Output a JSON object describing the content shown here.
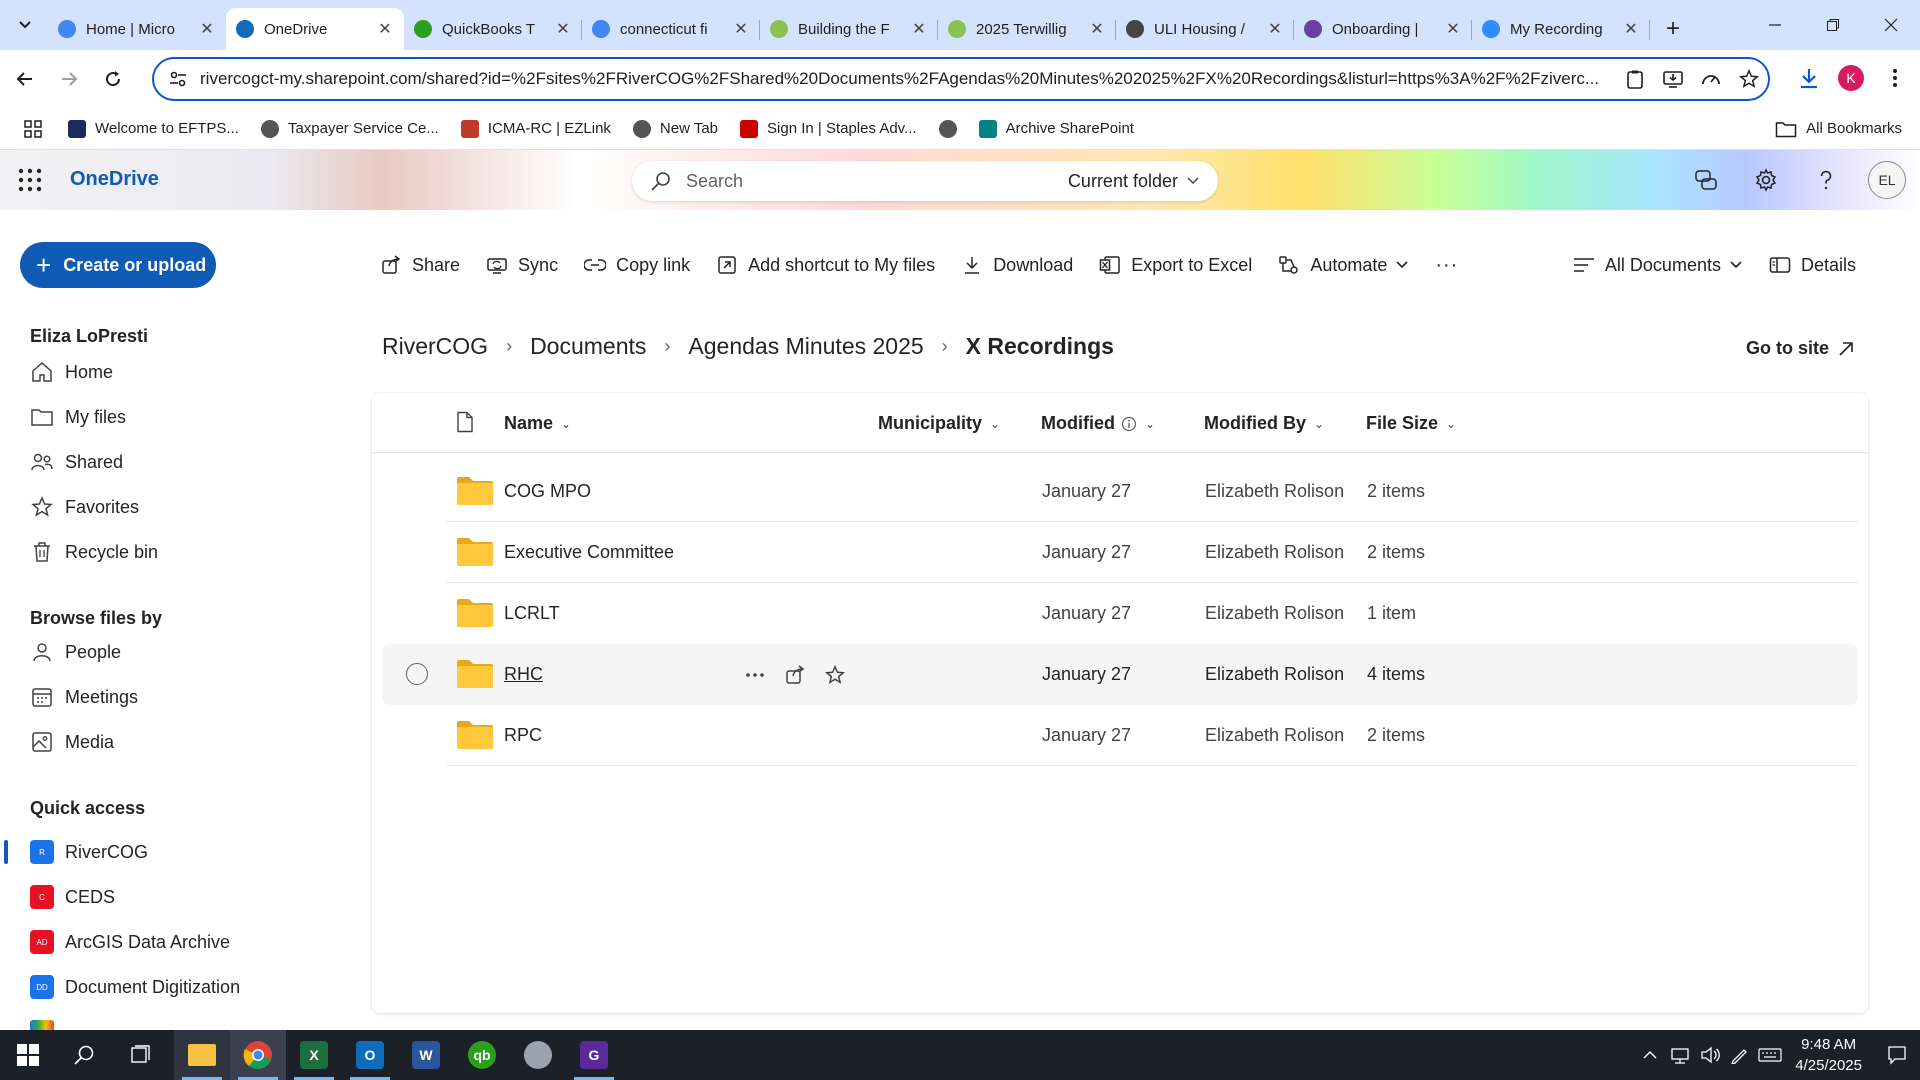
{
  "browser": {
    "tabs": [
      {
        "title": "Home | Micro",
        "favicon": "chrome-icon",
        "color": "#4285f4",
        "active": false
      },
      {
        "title": "OneDrive",
        "favicon": "onedrive-cloud-icon",
        "color": "#0f6cbd",
        "active": true
      },
      {
        "title": "QuickBooks T",
        "favicon": "quickbooks-icon",
        "color": "#2ca01c",
        "active": false
      },
      {
        "title": "connecticut fi",
        "favicon": "google-icon",
        "color": "#4285f4",
        "active": false
      },
      {
        "title": "Building the F",
        "favicon": "page-icon",
        "color": "#8cc152",
        "active": false
      },
      {
        "title": "2025 Terwillig",
        "favicon": "page-icon",
        "color": "#8cc152",
        "active": false
      },
      {
        "title": "ULI Housing /",
        "favicon": "globe-icon",
        "color": "#444444",
        "active": false
      },
      {
        "title": "Onboarding |",
        "favicon": "g-icon",
        "color": "#6b3fa0",
        "active": false
      },
      {
        "title": "My Recording",
        "favicon": "zoom-icon",
        "color": "#2d8cff",
        "active": false
      }
    ],
    "url": "rivercogct-my.sharepoint.com/shared?id=%2Fsites%2FRiverCOG%2FShared%20Documents%2FAgendas%20Minutes%202025%2FX%20Recordings&listurl=https%3A%2F%2Fziverc...",
    "profile_initial": "K",
    "bookmarks": [
      {
        "label": "Welcome to EFTPS...",
        "icon": "eftps-icon",
        "color": "#1a2a5a"
      },
      {
        "label": "Taxpayer Service Ce...",
        "icon": "globe-icon",
        "color": "#555555"
      },
      {
        "label": "ICMA-RC | EZLink",
        "icon": "icma-icon",
        "color": "#c0392b"
      },
      {
        "label": "New Tab",
        "icon": "globe-icon",
        "color": "#555555"
      },
      {
        "label": "Sign In | Staples Adv...",
        "icon": "staples-icon",
        "color": "#cc0000"
      },
      {
        "label": "",
        "icon": "globe-icon",
        "color": "#555555"
      },
      {
        "label": "Archive SharePoint",
        "icon": "sharepoint-icon",
        "color": "#038387"
      }
    ],
    "all_bookmarks_label": "All Bookmarks"
  },
  "onedrive": {
    "brand": "OneDrive",
    "search_placeholder": "Search",
    "search_scope": "Current folder",
    "user_initials": "EL",
    "create_label": "Create or upload",
    "user_name": "Eliza LoPresti",
    "nav": [
      {
        "label": "Home",
        "icon": "home-icon"
      },
      {
        "label": "My files",
        "icon": "folder-icon"
      },
      {
        "label": "Shared",
        "icon": "people-icon"
      },
      {
        "label": "Favorites",
        "icon": "star-icon"
      },
      {
        "label": "Recycle bin",
        "icon": "trash-icon"
      }
    ],
    "browse_heading": "Browse files by",
    "browse": [
      {
        "label": "People",
        "icon": "person-icon"
      },
      {
        "label": "Meetings",
        "icon": "calendar-icon"
      },
      {
        "label": "Media",
        "icon": "image-icon"
      }
    ],
    "quick_access_heading": "Quick access",
    "quick_access": [
      {
        "label": "RiverCOG",
        "badge": "R",
        "color": "#1a73e8"
      },
      {
        "label": "CEDS",
        "badge": "C",
        "color": "#e81123"
      },
      {
        "label": "ArcGIS Data Archive",
        "badge": "AD",
        "color": "#e81123"
      },
      {
        "label": "Document Digitization",
        "badge": "DD",
        "color": "#1a73e8"
      }
    ],
    "commands": {
      "share": "Share",
      "sync": "Sync",
      "copy_link": "Copy link",
      "add_shortcut": "Add shortcut to My files",
      "download": "Download",
      "export": "Export to Excel",
      "automate": "Automate",
      "more": "···",
      "view": "All Documents",
      "details": "Details"
    },
    "breadcrumb": [
      "RiverCOG",
      "Documents",
      "Agendas Minutes 2025"
    ],
    "breadcrumb_current": "X Recordings",
    "goto_site": "Go to site",
    "columns": {
      "name": "Name",
      "municipality": "Municipality",
      "modified": "Modified",
      "modified_by": "Modified By",
      "file_size": "File Size"
    },
    "rows": [
      {
        "name": "COG MPO",
        "modified": "January 27",
        "modified_by": "Elizabeth Rolison",
        "size": "2 items"
      },
      {
        "name": "Executive Committee",
        "modified": "January 27",
        "modified_by": "Elizabeth Rolison",
        "size": "2 items"
      },
      {
        "name": "LCRLT",
        "modified": "January 27",
        "modified_by": "Elizabeth Rolison",
        "size": "1 item"
      },
      {
        "name": "RHC",
        "modified": "January 27",
        "modified_by": "Elizabeth Rolison",
        "size": "4 items"
      },
      {
        "name": "RPC",
        "modified": "January 27",
        "modified_by": "Elizabeth Rolison",
        "size": "2 items"
      }
    ]
  },
  "taskbar": {
    "time": "9:48 AM",
    "date": "4/25/2025"
  }
}
